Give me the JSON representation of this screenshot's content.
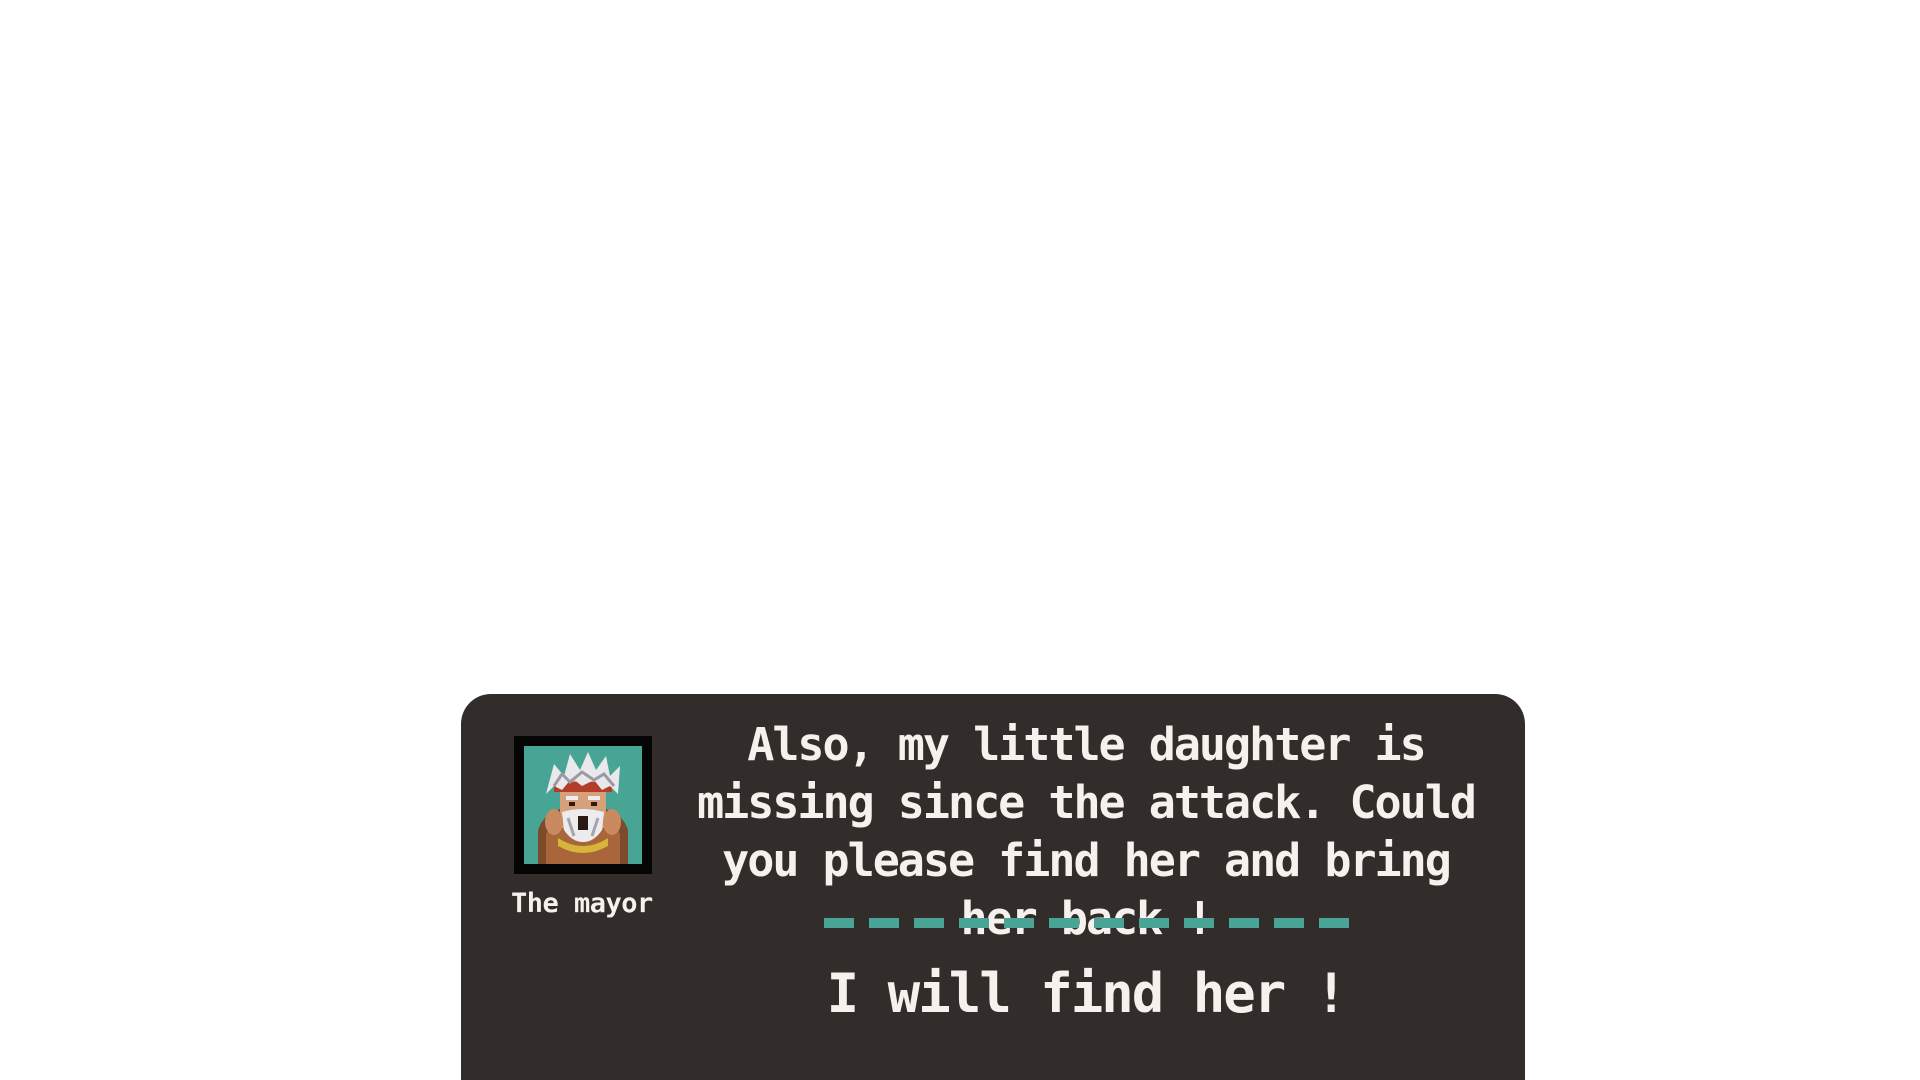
{
  "dialog": {
    "speaker_name": "The mayor",
    "message": "Also, my little daughter is missing since the attack. Could you please find her and bring her back !",
    "choices": [
      {
        "label": "I will find her !"
      }
    ],
    "portrait_icon": "mayor-portrait",
    "divider_segments": 12
  },
  "colors": {
    "dialog_background": "#322c2a",
    "text": "#f6f1ec",
    "accent": "#48a596",
    "portrait_frame": "#050505"
  }
}
